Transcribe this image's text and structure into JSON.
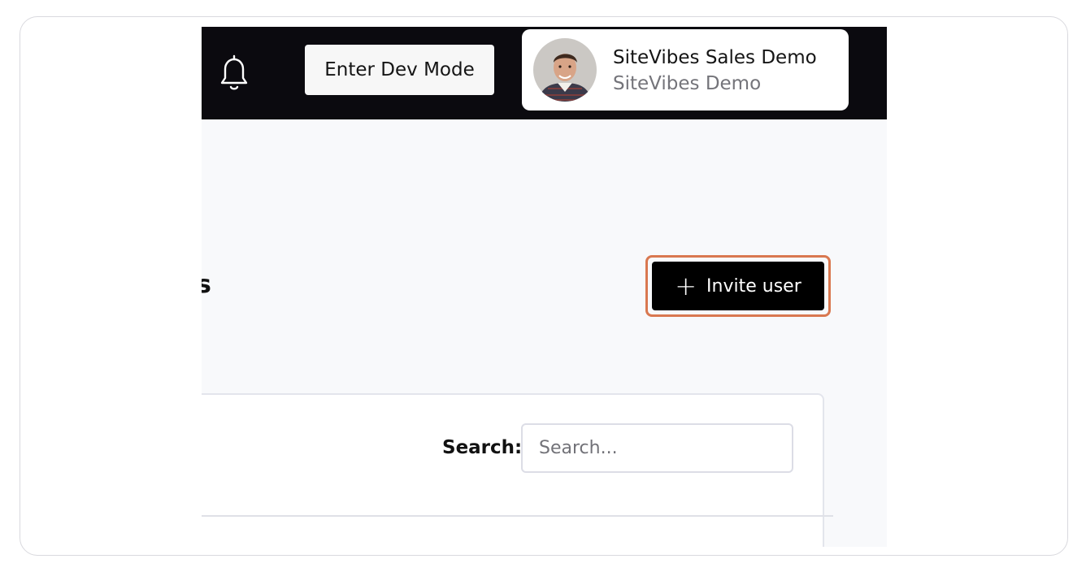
{
  "header": {
    "dev_mode_label": "Enter Dev Mode",
    "profile": {
      "name": "SiteVibes Sales Demo",
      "organization": "SiteVibes Demo"
    }
  },
  "page": {
    "title_fragment": "s",
    "invite_button_label": "Invite user"
  },
  "search": {
    "label": "Search:",
    "placeholder": "Search...",
    "value": ""
  },
  "colors": {
    "topbar": "#0b0a0f",
    "focus_ring": "#d97850",
    "primary_button": "#000000"
  }
}
